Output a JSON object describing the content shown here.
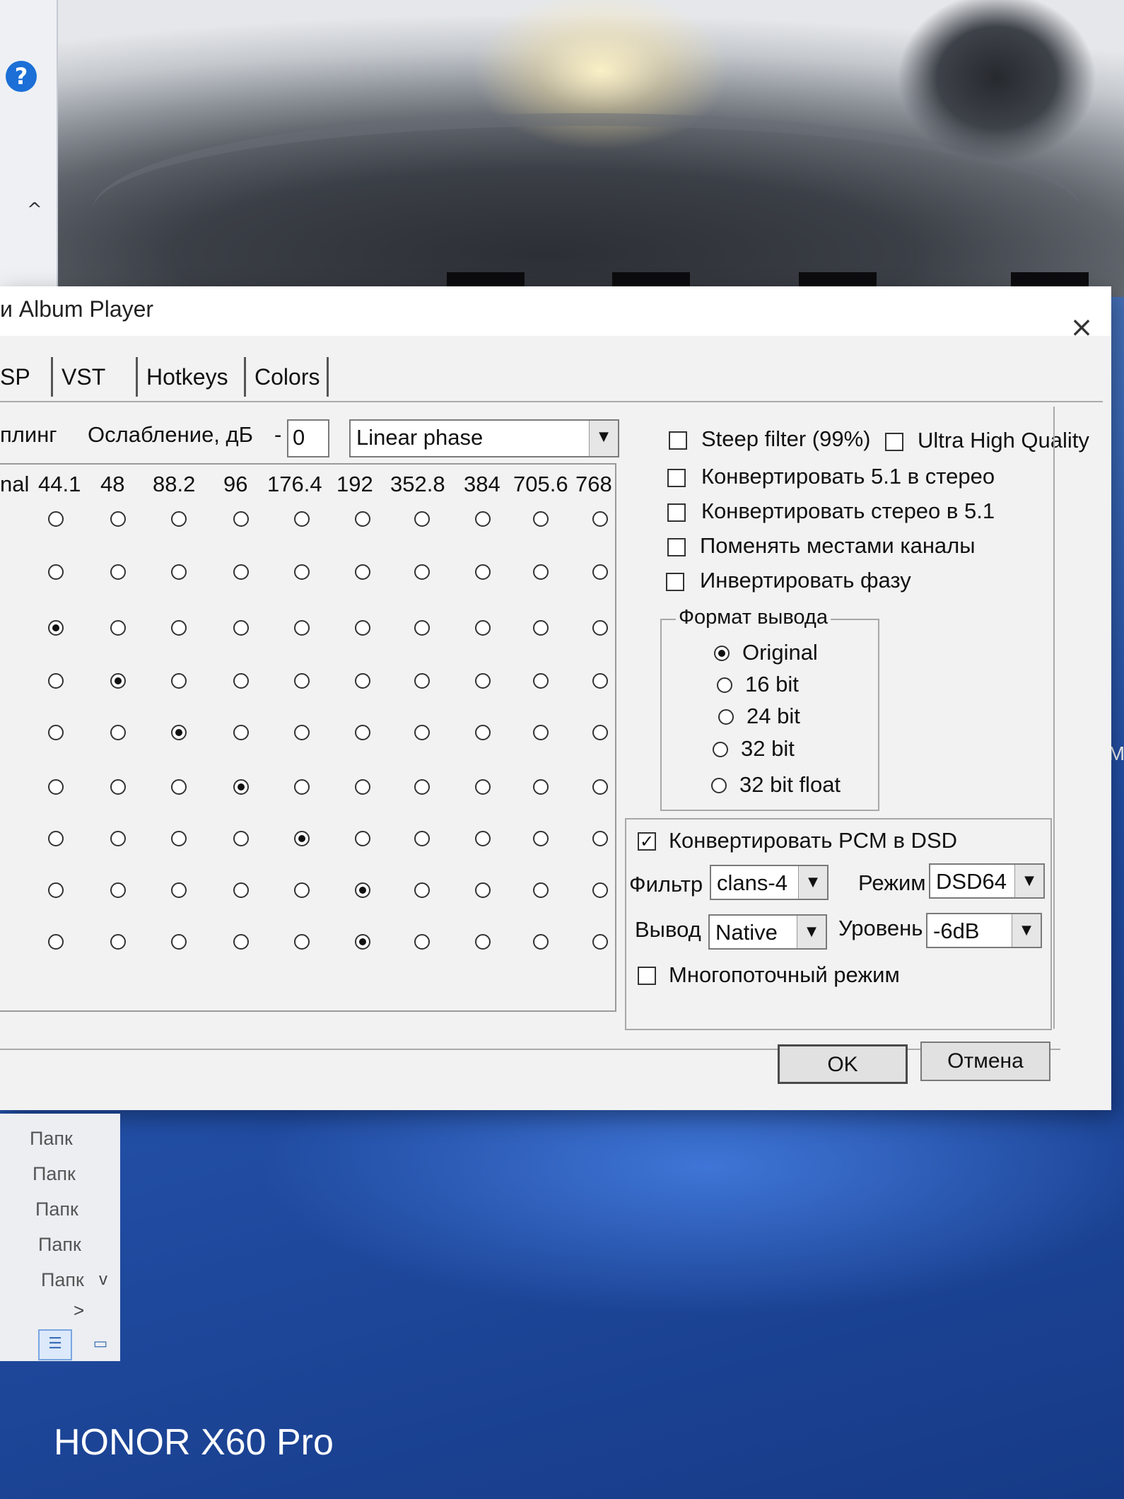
{
  "dialog": {
    "title": "и Album Player",
    "tabs": [
      {
        "label": "SP"
      },
      {
        "label": "VST"
      },
      {
        "label": "Hotkeys"
      },
      {
        "label": "Colors"
      }
    ],
    "resampling": {
      "label_partial": "плинг",
      "attenuation_label": "Ослабление, дБ",
      "attenuation_sign": "-",
      "attenuation_value": "0",
      "filter_type": "Linear phase",
      "columns": [
        "nal",
        "44.1",
        "48",
        "88.2",
        "96",
        "176.4",
        "192",
        "352.8",
        "384",
        "705.6",
        "768"
      ],
      "selected_per_row": [
        -1,
        -1,
        1,
        2,
        3,
        4,
        5,
        6,
        6
      ]
    },
    "options": {
      "steep_filter": {
        "label": "Steep filter (99%)",
        "checked": false
      },
      "ultra_high_quality": {
        "label": "Ultra High Quality",
        "checked": false
      },
      "convert_51_to_stereo": {
        "label": "Конвертировать 5.1 в стерео",
        "checked": false
      },
      "convert_stereo_to_51": {
        "label": "Конвертировать стерео в 5.1",
        "checked": false
      },
      "swap_channels": {
        "label": "Поменять местами каналы",
        "checked": false
      },
      "invert_phase": {
        "label": "Инвертировать фазу",
        "checked": false
      }
    },
    "output_format": {
      "title": "Формат вывода",
      "options": [
        "Original",
        "16 bit",
        "24 bit",
        "32 bit",
        "32 bit float"
      ],
      "selected": "Original"
    },
    "dsd": {
      "convert_label": "Конвертировать PCM в DSD",
      "convert_checked": true,
      "filter_label": "Фильтр",
      "filter_value": "clans-4",
      "mode_label": "Режим",
      "mode_value": "DSD64",
      "output_label": "Вывод",
      "output_value": "Native",
      "level_label": "Уровень",
      "level_value": "-6dB",
      "multithread_label": "Многопоточный режим",
      "multithread_checked": false
    },
    "buttons": {
      "ok": "OK",
      "cancel": "Отмена"
    }
  },
  "explorer": {
    "items": [
      "Папк",
      "Папк",
      "Папк",
      "Папк",
      "Папк"
    ]
  },
  "edge_text": "IM",
  "watermark": "HONOR X60 Pro",
  "colors": {
    "accent": "#1b6fd6",
    "dialog_bg": "#f2f2f2"
  }
}
